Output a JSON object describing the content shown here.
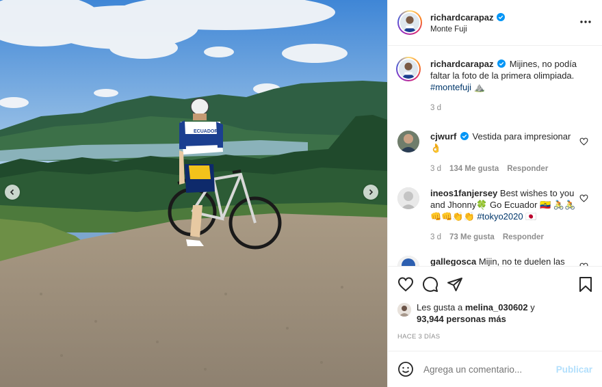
{
  "post": {
    "header": {
      "username": "richardcarapaz",
      "location": "Monte Fuji",
      "verified": true
    },
    "caption": {
      "username": "richardcarapaz",
      "text": "Mijines, no podía faltar la foto de la primera olimpiada.",
      "hashtag": "#montefuji",
      "emoji": "⛰️",
      "age": "3 d"
    },
    "comments": [
      {
        "username": "cjwurf",
        "verified": true,
        "text": "Vestida para impresionar👌",
        "age": "3 d",
        "likes": "134 Me gusta",
        "reply": "Responder"
      },
      {
        "username": "ineos1fanjersey",
        "verified": false,
        "text": "Best wishes to you and Jhonny🍀 Go Ecuador 🇪🇨 🚴🚴👊👊👏👏",
        "hashtag": "#tokyo2020",
        "extra": "🇯🇵",
        "age": "3 d",
        "likes": "73 Me gusta",
        "reply": "Responder"
      },
      {
        "username": "gallegosca",
        "verified": false,
        "text": "Mijin, no te duelen las"
      }
    ],
    "likes": {
      "prefix": "Les gusta a",
      "user": "melina_030602",
      "connector": "y",
      "count": "93,944 personas más"
    },
    "time_ago": "HACE 3 DÍAS",
    "comment_box": {
      "placeholder": "Agrega un comentario...",
      "publish_label": "Publicar"
    },
    "photo": {
      "jersey_text": "ECUADOR"
    }
  },
  "colors": {
    "verified": "#0095f6",
    "hashtag": "#00376b",
    "muted": "#8e8e8e",
    "publish": "#b2dffc"
  },
  "icons": [
    "more-options-icon",
    "heart-icon",
    "comment-icon",
    "share-icon",
    "save-icon",
    "emoji-icon",
    "chevron-left-icon",
    "chevron-right-icon",
    "verified-badge-icon"
  ]
}
